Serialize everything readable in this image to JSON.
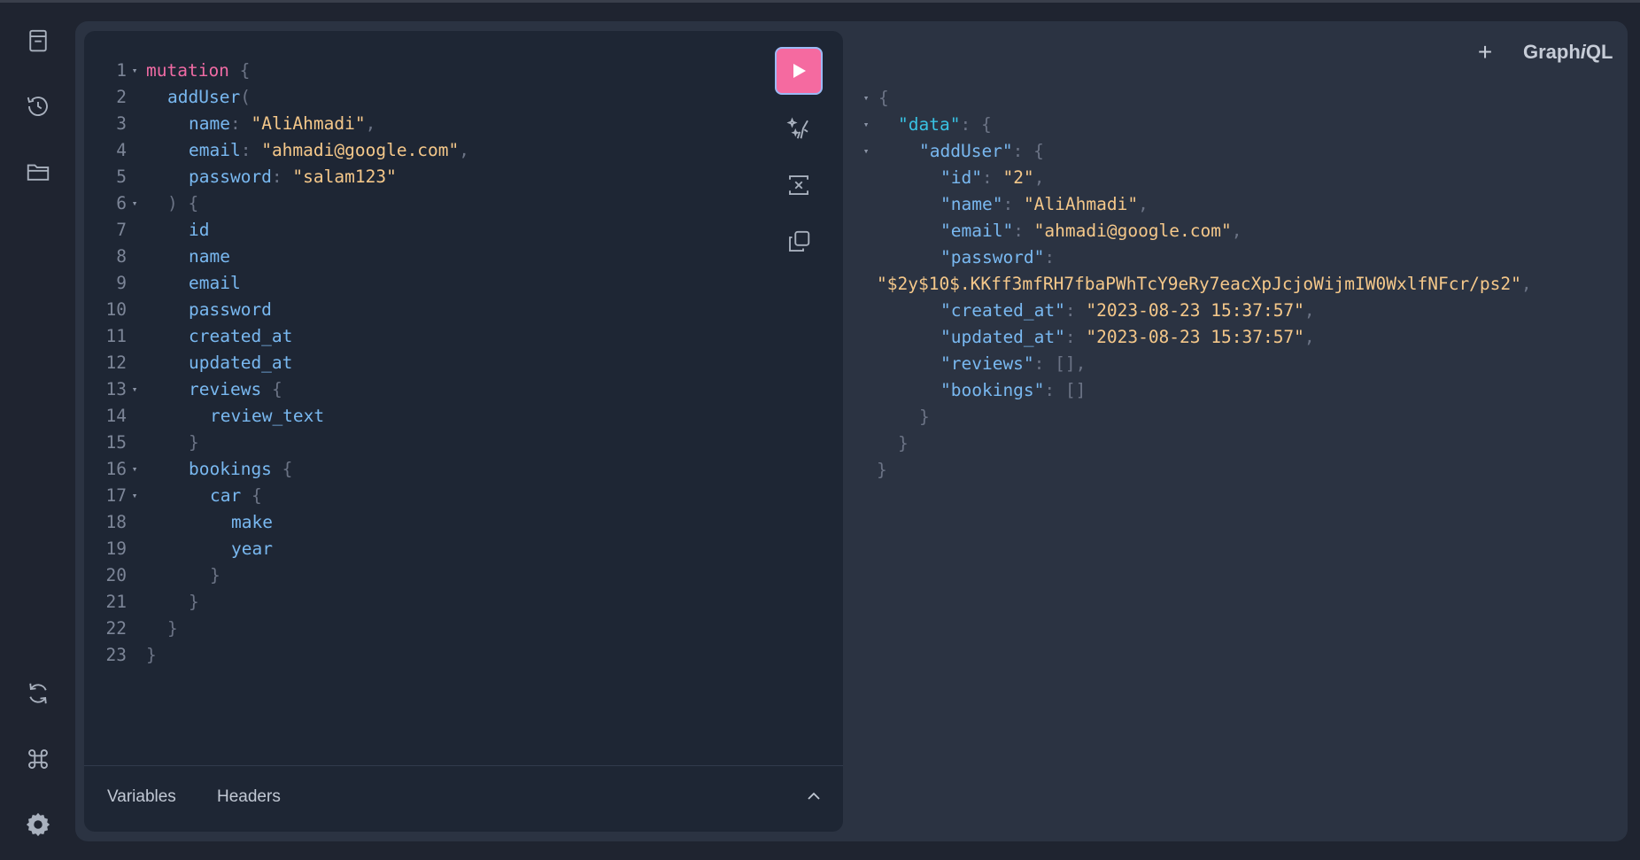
{
  "brand": {
    "prefix": "Graph",
    "italic": "i",
    "suffix": "QL",
    "add_label": "+"
  },
  "sidebar": {
    "top": [
      "docs-icon",
      "history-icon",
      "collection-icon"
    ],
    "bottom": [
      "refetch-icon",
      "shortcut-icon",
      "settings-icon"
    ]
  },
  "editor": {
    "line_numbers": [
      "1",
      "2",
      "3",
      "4",
      "5",
      "6",
      "7",
      "8",
      "9",
      "10",
      "11",
      "12",
      "13",
      "14",
      "15",
      "16",
      "17",
      "18",
      "19",
      "20",
      "21",
      "22",
      "23"
    ],
    "folds": [
      "▾",
      "",
      "",
      "",
      "",
      "▾",
      "",
      "",
      "",
      "",
      "",
      "",
      "▾",
      "",
      "",
      "▾",
      "▾",
      "",
      "",
      "",
      "",
      "",
      ""
    ],
    "tokens": {
      "mutation": "mutation",
      "open_brace": "{",
      "close_brace": "}",
      "addUser": "addUser",
      "paren_open": "(",
      "paren_close": ")",
      "name_arg": "name",
      "email_arg": "email",
      "password_arg": "password",
      "colon": ":",
      "comma": ",",
      "name_val": "\"AliAhmadi\"",
      "email_val": "\"ahmadi@google.com\"",
      "password_val": "\"salam123\"",
      "id": "id",
      "name": "name",
      "email": "email",
      "password": "password",
      "created_at": "created_at",
      "updated_at": "updated_at",
      "reviews": "reviews",
      "review_text": "review_text",
      "bookings": "bookings",
      "car": "car",
      "make": "make",
      "year": "year"
    },
    "tabs": {
      "variables": "Variables",
      "headers": "Headers"
    }
  },
  "tools": [
    "run-button",
    "prettify-icon",
    "merge-icon",
    "copy-icon"
  ],
  "result": {
    "open": "{",
    "close": "}",
    "colon": ": ",
    "comma": ",",
    "data_key": "\"data\"",
    "adduser_key": "\"addUser\"",
    "id_key": "\"id\"",
    "id_val": "\"2\"",
    "name_key": "\"name\"",
    "name_val": "\"AliAhmadi\"",
    "email_key": "\"email\"",
    "email_val": "\"ahmadi@google.com\"",
    "password_key": "\"password\"",
    "colon_only": ":",
    "password_val": "\"$2y$10$.KKff3mfRH7fbaPWhTcY9eRy7eacXpJcjoWijmIW0WxlfNFcr/ps2\"",
    "created_key": "\"created_at\"",
    "created_val": "\"2023-08-23 15:37:57\"",
    "updated_key": "\"updated_at\"",
    "updated_val": "\"2023-08-23 15:37:57\"",
    "reviews_key": "\"reviews\"",
    "reviews_val": "[]",
    "bookings_key": "\"bookings\"",
    "bookings_val": "[]",
    "fold": "▾"
  }
}
